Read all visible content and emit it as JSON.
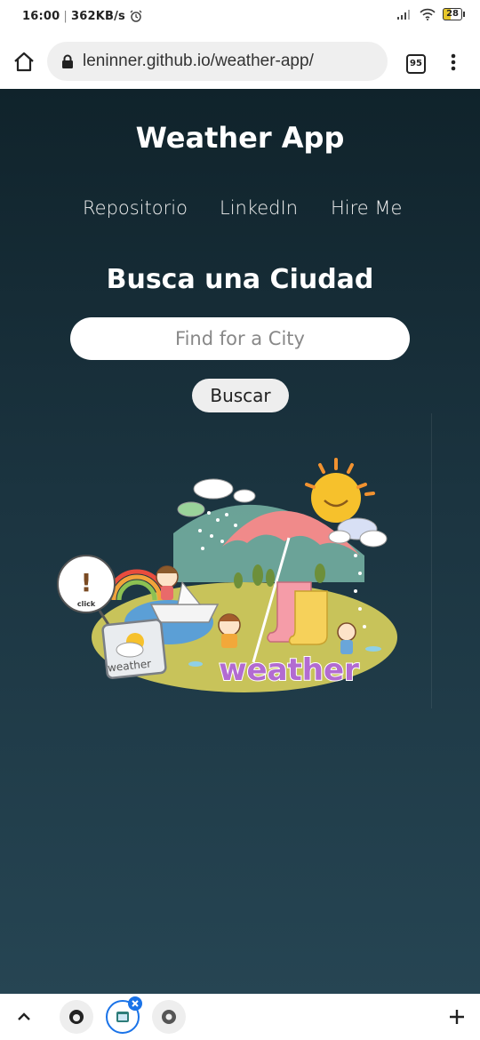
{
  "status_bar": {
    "time": "16:00",
    "net_speed": "362KB/s",
    "battery": "28"
  },
  "browser": {
    "url": "leninner.github.io/weather-app/",
    "tab_count": "95"
  },
  "header": {
    "title": "Weather App",
    "nav": [
      "Repositorio",
      "LinkedIn",
      "Hire Me"
    ]
  },
  "search": {
    "heading": "Busca una Ciudad",
    "placeholder": "Find for a City",
    "button_label": "Buscar"
  },
  "illustration": {
    "sign_mark": "!",
    "sign_text": "click",
    "card_text": "weather",
    "word_art": "weather"
  },
  "colors": {
    "bg_top": "#10232b",
    "bg_bottom": "#264553"
  }
}
